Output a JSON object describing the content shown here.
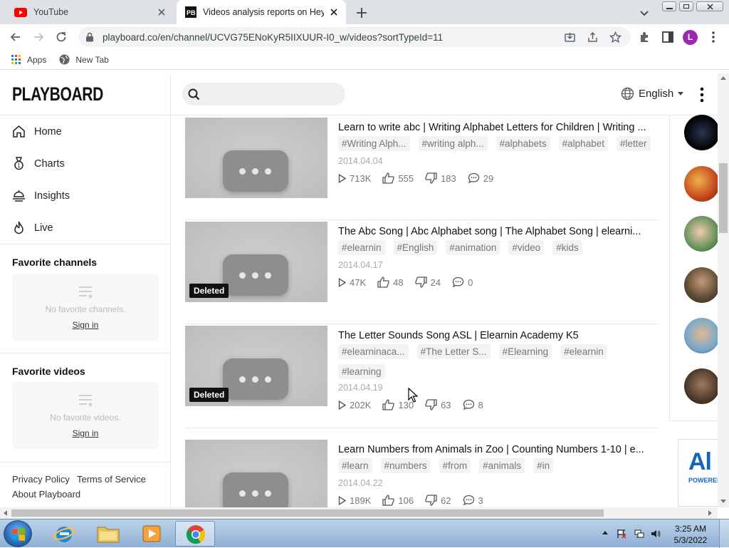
{
  "browser": {
    "tabs": [
      {
        "title": "YouTube",
        "active": false
      },
      {
        "title": "Videos analysis reports on Hey S",
        "active": true
      }
    ],
    "url": "playboard.co/en/channel/UCVG75ENoKyR5IIXUUR-I0_w/videos?sortTypeId=11",
    "profile_initial": "L",
    "bookmarks": [
      {
        "label": "Apps",
        "icon": "apps-grid-icon"
      },
      {
        "label": "New Tab",
        "icon": "globe-icon"
      }
    ]
  },
  "site": {
    "logo": "PLAYBOARD",
    "search_placeholder": "",
    "language": "English"
  },
  "sidebar": {
    "nav": [
      {
        "label": "Home",
        "icon": "home-icon"
      },
      {
        "label": "Charts",
        "icon": "medal-icon"
      },
      {
        "label": "Insights",
        "icon": "insights-icon"
      },
      {
        "label": "Live",
        "icon": "fire-icon"
      }
    ],
    "favorite_channels": {
      "title": "Favorite channels",
      "empty_text": "No favorite channels.",
      "signin": "Sign in"
    },
    "favorite_videos": {
      "title": "Favorite videos",
      "empty_text": "No favorite videos.",
      "signin": "Sign in"
    },
    "footer": {
      "privacy": "Privacy Policy",
      "terms": "Terms of Service",
      "about": "About Playboard"
    }
  },
  "videos": [
    {
      "title": "Learn to write abc | Writing Alphabet Letters for Children | Writing ...",
      "tags": [
        "#Writing Alph...",
        "#writing alph...",
        "#alphabets",
        "#alphabet",
        "#letter"
      ],
      "date": "2014.04.04",
      "views": "713K",
      "likes": "555",
      "dislikes": "183",
      "comments": "29",
      "deleted": false
    },
    {
      "title": "The Abc Song | Abc Alphabet song | The Alphabet Song | elearni...",
      "tags": [
        "#elearnin",
        "#English",
        "#animation",
        "#video",
        "#kids"
      ],
      "date": "2014.04.17",
      "views": "47K",
      "likes": "48",
      "dislikes": "24",
      "comments": "0",
      "deleted": true,
      "badge": "Deleted"
    },
    {
      "title": "The Letter Sounds Song ASL | Elearnin Academy K5",
      "tags": [
        "#elearninaca...",
        "#The Letter S...",
        "#Elearning",
        "#elearnin",
        "#learning"
      ],
      "date": "2014.04.19",
      "views": "202K",
      "likes": "130",
      "dislikes": "63",
      "comments": "8",
      "deleted": true,
      "badge": "Deleted"
    },
    {
      "title": "Learn Numbers from Animals in Zoo | Counting Numbers 1-10 | e...",
      "tags": [
        "#learn",
        "#numbers",
        "#from",
        "#animals",
        "#in"
      ],
      "date": "2014.04.22",
      "views": "189K",
      "likes": "106",
      "dislikes": "62",
      "comments": "3",
      "deleted": true,
      "badge": ""
    }
  ],
  "ad": {
    "big": "Al",
    "small": "POWEREI"
  },
  "taskbar": {
    "time": "3:25 AM",
    "date": "5/3/2022"
  },
  "colors": {
    "accent": "#9c27b0",
    "youtube_red": "#ff0000",
    "badge_bg": "#111111",
    "tag_bg": "#f3f3f3"
  }
}
